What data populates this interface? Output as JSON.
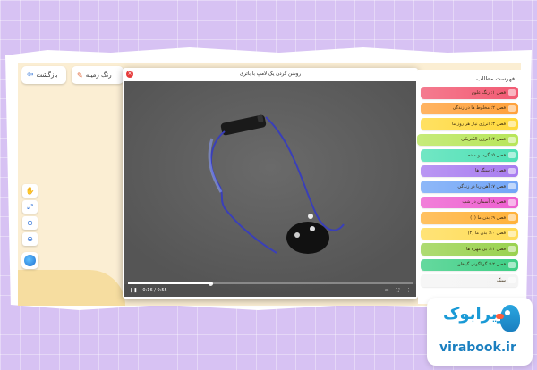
{
  "app": {
    "back_label": "بازگشت",
    "background_color_label": "رنگ زمینه"
  },
  "video": {
    "title": "روشن کردن یک لامپ با باتری",
    "time": "0:16 / 0:55",
    "progress_fraction": 0.29
  },
  "toc": {
    "title": "فهرست مطالب",
    "items": [
      {
        "label": "فصل ۱: رنگ علوم",
        "color": "#f25a73"
      },
      {
        "label": "فصل ۲: مخلوط ها در زندگی",
        "color": "#ffa13b"
      },
      {
        "label": "فصل ۳: انرژی نیاز هر روز ما",
        "color": "#ffd93b"
      },
      {
        "label": "فصل ۴: انرژی الکتریکی",
        "color": "#b8e65a"
      },
      {
        "label": "فصل ۵: گرما و ماده",
        "color": "#4ee0b5"
      },
      {
        "label": "فصل ۶: سنگ ها",
        "color": "#a87cf0"
      },
      {
        "label": "فصل ۷: آهن ربا در زندگی",
        "color": "#72a6f7"
      },
      {
        "label": "فصل ۸: آسمان در شب",
        "color": "#ee5fd0"
      },
      {
        "label": "فصل ۹: بدن ما (۱)",
        "color": "#ffb23a"
      },
      {
        "label": "فصل ۱۰: بدن ما (۲)",
        "color": "#ffdc56"
      },
      {
        "label": "فصل ۱۱: بی مهره ها",
        "color": "#9ad24f"
      },
      {
        "label": "فصل ۱۲: گوناگونی گیاهان",
        "color": "#3fcf86"
      },
      {
        "label": "سنگ",
        "color": "#f4f4f4"
      }
    ],
    "active_index": 3
  },
  "brand": {
    "logo_text": "ویرابوک",
    "url": "virabook.ir",
    "accent": "#1a9ad6"
  }
}
